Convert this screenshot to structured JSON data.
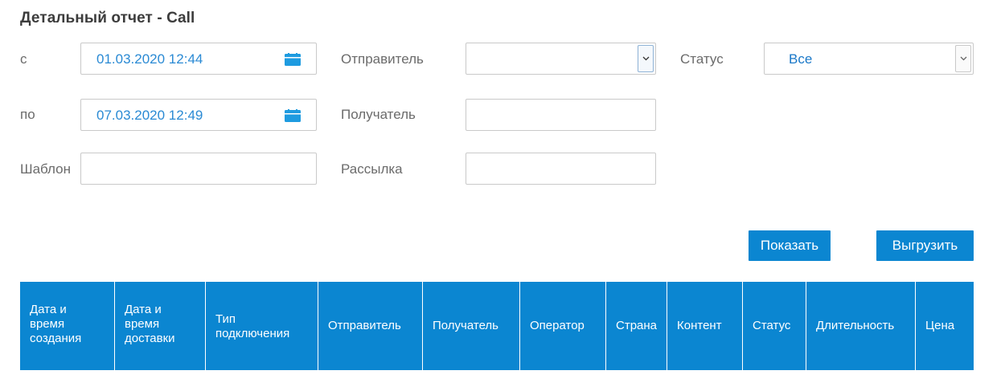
{
  "page": {
    "title": "Детальный отчет - Call"
  },
  "filters": {
    "from_label": "с",
    "from_value": "01.03.2020 12:44",
    "to_label": "по",
    "to_value": "07.03.2020 12:49",
    "template_label": "Шаблон",
    "template_value": "",
    "sender_label": "Отправитель",
    "sender_value": "",
    "recipient_label": "Получатель",
    "recipient_value": "",
    "mailing_label": "Рассылка",
    "mailing_value": "",
    "status_label": "Статус",
    "status_value": "Все"
  },
  "actions": {
    "show_label": "Показать",
    "export_label": "Выгрузить"
  },
  "table": {
    "columns": [
      "Дата и\nвремя\nсоздания",
      "Дата и\nвремя\nдоставки",
      "Тип\nподключения",
      "Отправитель",
      "Получатель",
      "Оператор",
      "Страна",
      "Контент",
      "Статус",
      "Длительность",
      "Цена"
    ]
  },
  "icons": {
    "calendar": "calendar-icon",
    "dropdown": "chevron-down-icon"
  },
  "colors": {
    "accent": "#0b86d1",
    "value_text": "#2a8ad4",
    "calendar": "#1e9be0"
  }
}
